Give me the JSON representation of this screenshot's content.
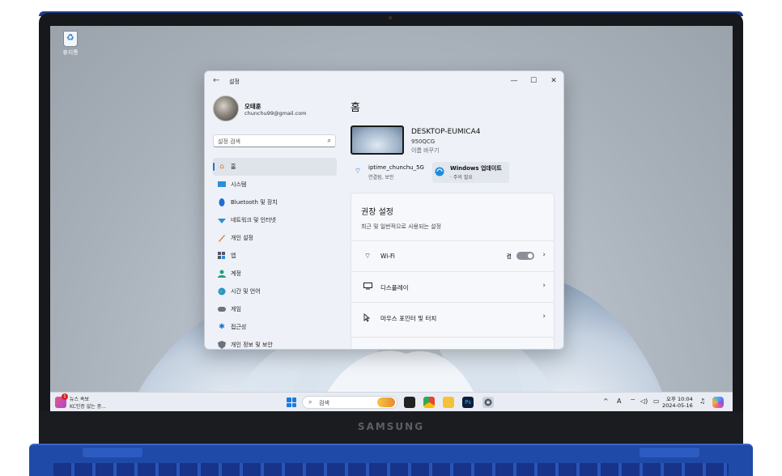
{
  "desktop": {
    "recycle_label": "휴지통"
  },
  "device_brand": "SAMSUNG",
  "window": {
    "title": "설정",
    "buttons": {
      "minimize": "—",
      "maximize": "☐",
      "close": "✕"
    },
    "back_glyph": "←"
  },
  "profile": {
    "name": "오태훈",
    "email": "chunchu99@gmail.com"
  },
  "search": {
    "placeholder": "설정 검색",
    "icon": "search-icon"
  },
  "nav": [
    {
      "label": "홈",
      "icon": "home-icon",
      "active": true
    },
    {
      "label": "시스템",
      "icon": "monitor-icon"
    },
    {
      "label": "Bluetooth 및 장치",
      "icon": "bluetooth-icon"
    },
    {
      "label": "네트워크 및 인터넷",
      "icon": "network-icon"
    },
    {
      "label": "개인 설정",
      "icon": "brush-icon"
    },
    {
      "label": "앱",
      "icon": "apps-icon"
    },
    {
      "label": "계정",
      "icon": "account-icon"
    },
    {
      "label": "시간 및 언어",
      "icon": "globe-icon"
    },
    {
      "label": "게임",
      "icon": "gamepad-icon"
    },
    {
      "label": "접근성",
      "icon": "accessibility-icon"
    },
    {
      "label": "개인 정보 및 보안",
      "icon": "shield-icon"
    }
  ],
  "home": {
    "title": "홈",
    "device": {
      "name": "DESKTOP-EUMICA4",
      "model": "950QCG",
      "rename": "이름 바꾸기"
    },
    "wifi_chip": {
      "title": "iptime_chunchu_5G",
      "subtitle": "연결됨, 보안"
    },
    "update_chip": {
      "title": "Windows 업데이트",
      "subtitle": "· 주의 필요"
    },
    "recommended": {
      "title": "권장 설정",
      "subtitle": "최근 및 일반적으로 사용되는 설정",
      "rows": [
        {
          "label": "Wi-Fi",
          "state": "켬",
          "toggle_on": true,
          "icon": "wifi-icon"
        },
        {
          "label": "디스플레이",
          "icon": "display-icon"
        },
        {
          "label": "마우스 포인터 및 터치",
          "icon": "mouse-pointer-icon"
        }
      ]
    }
  },
  "taskbar": {
    "news": {
      "title": "뉴스 속보",
      "subtitle": "KC인증 없는 중...",
      "badge": "1"
    },
    "search_text": "검색",
    "tray": {
      "chevron": "^",
      "ime": "A"
    },
    "clock": {
      "ampm_time": "오후 10:04",
      "date": "2024-05-16"
    }
  }
}
